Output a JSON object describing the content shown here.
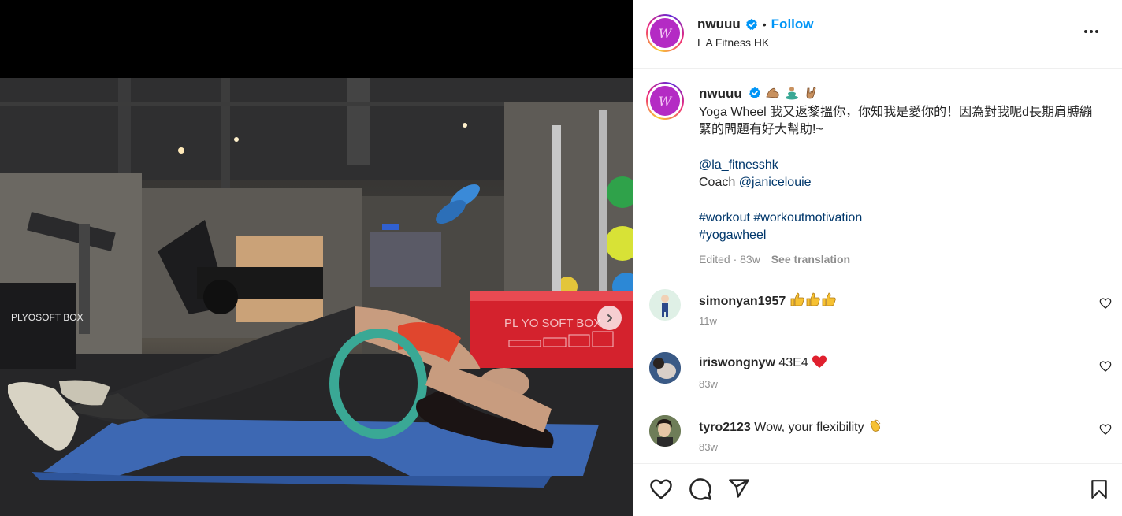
{
  "post": {
    "username": "nwuuu",
    "follow_label": "Follow",
    "separator": "•",
    "location": "L A Fitness HK",
    "avatar_letter": "W"
  },
  "caption": {
    "username": "nwuuu",
    "text_line": "Yoga Wheel 我又返黎搵你，你知我是愛你的！因為對我呢d長期肩膊繃緊的問題有好大幫助!~",
    "mention1": "@la_fitnesshk",
    "coach_prefix": "Coach ",
    "mention2": "@janicelouie",
    "hashtag1": "#workout",
    "hashtag2": "#workoutmotivation",
    "hashtag3": "#yogawheel",
    "edited": "Edited · 83w",
    "see_translation": "See translation"
  },
  "photo": {
    "box_sign_left": "PLYOSOFT BOX",
    "box_sign_right": "PL YO SOFT BOX"
  },
  "comments": [
    {
      "username": "simonyan1957",
      "text": "",
      "time": "11w"
    },
    {
      "username": "iriswongnyw",
      "text": "43E4",
      "time": "83w"
    },
    {
      "username": "tyro2123",
      "text": "Wow, your flexibility",
      "time": "83w"
    }
  ],
  "colors": {
    "link": "#00376b",
    "follow": "#0095f6",
    "verified": "#0095f6",
    "avatar_bg": "#b42bc4"
  }
}
